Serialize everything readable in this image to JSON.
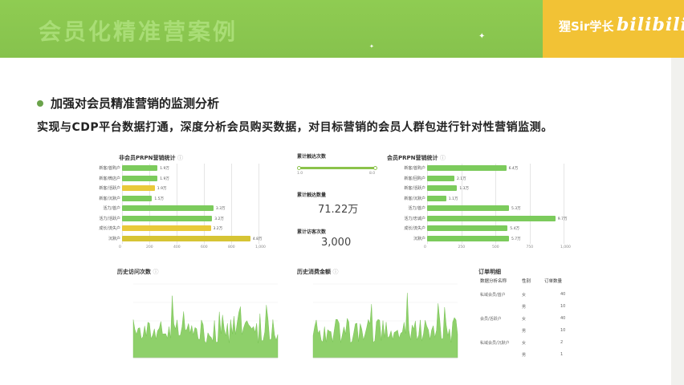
{
  "header": {
    "title": "会员化精准营案例",
    "brand_text": "猩Sir学长",
    "brand_logo": "bilibili"
  },
  "slide": {
    "bullet": "加强对会员精准营销的监测分析",
    "description": "实现与CDP平台数据打通，深度分析会员购买数据，对目标营销的会员人群包进行针对性营销监测。"
  },
  "panels": {
    "left_bar": {
      "title": "非会员PRPN营销统计",
      "rows": [
        {
          "label": "新客/首购户",
          "value": "1.9万",
          "v": 0.26,
          "color": "#7ccb5c"
        },
        {
          "label": "新客/微店户",
          "value": "1.9万",
          "v": 0.26,
          "color": "#7ccb5c"
        },
        {
          "label": "新客/活跃户",
          "value": "1.9万",
          "v": 0.24,
          "color": "#e9c93a"
        },
        {
          "label": "新客/沉默户",
          "value": "1.5万",
          "v": 0.22,
          "color": "#7ccb5c"
        },
        {
          "label": "活力/首户",
          "value": "3.3万",
          "v": 0.67,
          "color": "#7ccb5c"
        },
        {
          "label": "活力/活跃户",
          "value": "3.2万",
          "v": 0.66,
          "color": "#7ccb5c"
        },
        {
          "label": "成长/流失户",
          "value": "3.2万",
          "v": 0.65,
          "color": "#e9c93a"
        },
        {
          "label": "沉默户",
          "value": "4.8万",
          "v": 0.94,
          "color": "#d6c434"
        }
      ],
      "ticks": [
        "0",
        "200",
        "400",
        "600",
        "800",
        "1,000"
      ]
    },
    "stats": {
      "title": "累计触达次数",
      "slider_min": "1.0",
      "slider_max": "8.0",
      "reach_label": "累计触达数量",
      "reach_value": "71.22万",
      "visit_label": "累计访客次数",
      "visit_value": "3,000"
    },
    "right_bar": {
      "title": "会员PRPN营销统计",
      "rows": [
        {
          "label": "新客/首购户",
          "value": "6.4万",
          "v": 0.58,
          "color": "#7ccb5c"
        },
        {
          "label": "新客/回购户",
          "value": "2.1万",
          "v": 0.2,
          "color": "#7ccb5c"
        },
        {
          "label": "新客/活跃户",
          "value": "1.3万",
          "v": 0.22,
          "color": "#7ccb5c"
        },
        {
          "label": "新客/沉默户",
          "value": "1.1万",
          "v": 0.14,
          "color": "#7ccb5c"
        },
        {
          "label": "活力/首户",
          "value": "5.3万",
          "v": 0.6,
          "color": "#7ccb5c"
        },
        {
          "label": "活力/忠诚户",
          "value": "9.7万",
          "v": 0.94,
          "color": "#7ccb5c"
        },
        {
          "label": "成长/流失户",
          "value": "5.4万",
          "v": 0.59,
          "color": "#7ccb5c"
        },
        {
          "label": "沉默户",
          "value": "5.7万",
          "v": 0.6,
          "color": "#7ccb5c"
        }
      ],
      "ticks": [
        "0",
        "250",
        "500",
        "750",
        "1,000"
      ]
    },
    "area1": {
      "title": "历史访问次数"
    },
    "area2": {
      "title": "历史消费金额"
    },
    "table": {
      "title": "订单明细",
      "headers": [
        "数据分析名称",
        "性别",
        "订单数量"
      ],
      "rows": [
        [
          "私域会员/首户",
          "女",
          "40"
        ],
        [
          "",
          "男",
          "10"
        ],
        [
          "会员/活跃户",
          "女",
          "40"
        ],
        [
          "",
          "男",
          "10"
        ],
        [
          "私域会员/沉默户",
          "女",
          "2"
        ],
        [
          "",
          "男",
          "1"
        ]
      ]
    }
  }
}
